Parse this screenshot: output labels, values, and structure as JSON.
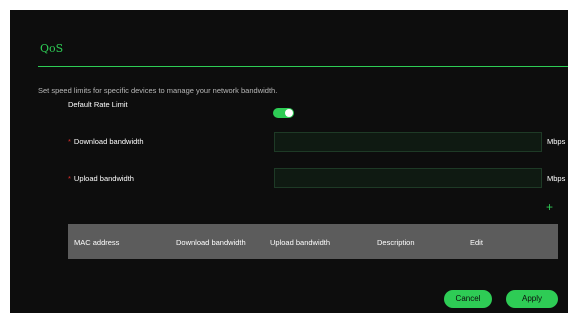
{
  "header": {
    "title": "QoS"
  },
  "description": "Set speed limits for specific devices to manage your network bandwidth.",
  "default_rate_limit": {
    "label": "Default Rate Limit",
    "enabled": true
  },
  "download": {
    "label": "Download bandwidth",
    "value": "",
    "unit": "Mbps",
    "required_mark": "*"
  },
  "upload": {
    "label": "Upload bandwidth",
    "value": "",
    "unit": "Mbps",
    "required_mark": "*"
  },
  "table": {
    "add_icon": "plus-icon",
    "columns": [
      "MAC address",
      "Download bandwidth",
      "Upload bandwidth",
      "Description",
      "Edit"
    ]
  },
  "actions": {
    "cancel_label": "Cancel",
    "apply_label": "Apply"
  },
  "colors": {
    "accent": "#2ecc55",
    "background": "#0d0d0d",
    "table_header": "#5c5c5c"
  }
}
